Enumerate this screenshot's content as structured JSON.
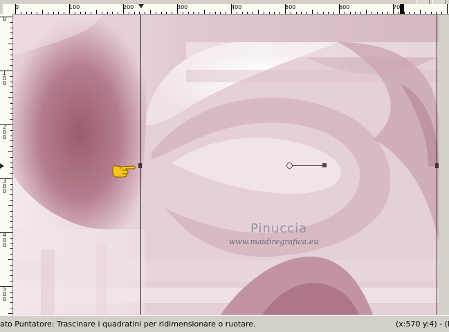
{
  "ruler_horizontal": {
    "labels": [
      "0",
      "100",
      "200",
      "300",
      "400",
      "500",
      "600",
      "700"
    ]
  },
  "ruler_vertical": {
    "labels": [
      "0",
      "1\n0\n0",
      "2\n0\n0",
      "3\n0\n0",
      "4\n0\n0",
      "5\n0\n0"
    ]
  },
  "canvas": {
    "watermark_title": "Pinuccia",
    "watermark_url": "www.maidiregrafica.eu",
    "colors": {
      "base": "#e7d3d9",
      "dark_rose": "#9c5c6e",
      "light": "#f8f1f3",
      "mid": "#c79eaa"
    }
  },
  "status": {
    "message": "ato Puntatore: Trascinare i quadratini per ridimensionare o ruotare.",
    "coords": "(x:570 y:4) - (R"
  },
  "icons": {
    "pointer": "pointing-hand-icon",
    "rotation_center": "rotation-center-icon"
  }
}
